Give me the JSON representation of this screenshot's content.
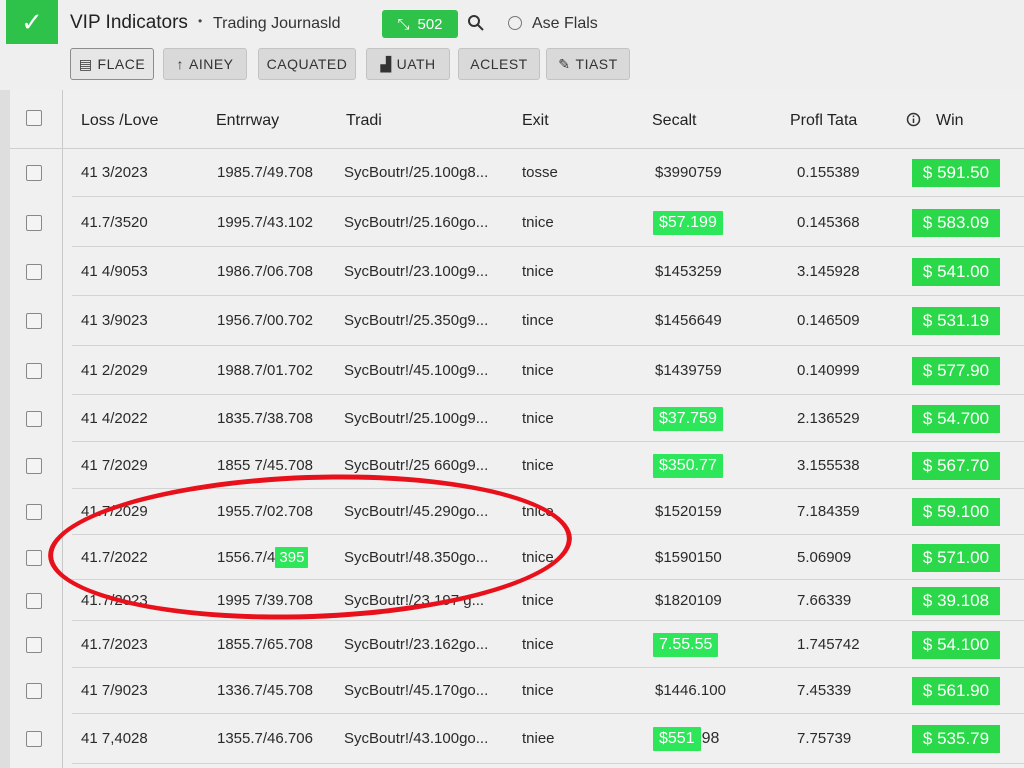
{
  "app": {
    "title": "VIP Indicators",
    "separator": "•",
    "subtitle": "Trading Journasld",
    "count_badge": "502",
    "filter_label": "Ase Flals"
  },
  "toolbar": [
    {
      "icon": "grid-icon",
      "glyph": "▤",
      "label": "FLACE"
    },
    {
      "icon": "arrow-up-icon",
      "glyph": "↑",
      "label": "AINEY"
    },
    {
      "icon": "",
      "glyph": "",
      "label": "CAQUATED"
    },
    {
      "icon": "chart-icon",
      "glyph": "▟",
      "label": "UATH"
    },
    {
      "icon": "",
      "glyph": "",
      "label": "ACLEST"
    },
    {
      "icon": "pencil-icon",
      "glyph": "✎",
      "label": "TIAST"
    }
  ],
  "columns": [
    "Loss /Love",
    "Entrrway",
    "Tradi",
    "Exit",
    "Secalt",
    "Profl Tata",
    "Win"
  ],
  "rows": [
    {
      "loss": "41 3/2023",
      "entry": "1985.7/49.708",
      "trade": "SycBoutr!/25.100g8...",
      "exit": "tosse",
      "secalt": "$3990759",
      "profit": "0.155389",
      "win": "$ 591.50"
    },
    {
      "loss": "41.7/3520",
      "entry": "1995.7/43.102",
      "trade": "SycBoutr!/25.160go...",
      "exit": "tnice",
      "secalt": "$57.199",
      "profit": "0.145368",
      "win": "$ 583.09"
    },
    {
      "loss": "41 4/9053",
      "entry": "1986.7/06.708",
      "trade": "SycBoutr!/23.100g9...",
      "exit": "tnice",
      "secalt": "$1453259",
      "profit": "3.145928",
      "win": "$ 541.00"
    },
    {
      "loss": "41 3/9023",
      "entry": "1956.7/00.702",
      "trade": "SycBoutr!/25.350g9...",
      "exit": "tince",
      "secalt": "$1456649",
      "profit": "0.146509",
      "win": "$ 531.19"
    },
    {
      "loss": "41 2/2029",
      "entry": "1988.7/01.702",
      "trade": "SycBoutr!/45.100g9...",
      "exit": "tnice",
      "secalt": "$1439759",
      "profit": "0.140999",
      "win": "$ 577.90"
    },
    {
      "loss": "41 4/2022",
      "entry": "1835.7/38.708",
      "trade": "SycBoutr!/25.100g9...",
      "exit": "tnice",
      "secalt": "$37.759",
      "profit": "2.136529",
      "win": "$ 54.700"
    },
    {
      "loss": "41 7/2029",
      "entry": "1855 7/45.708",
      "trade": "SycBoutr!/25 660g9...",
      "exit": "tnice",
      "secalt": "$350.77",
      "profit": "3.155538",
      "win": "$ 567.70"
    },
    {
      "loss": "41.7/2029",
      "entry": "1955.7/02.708",
      "trade": "SycBoutr!/45.290go...",
      "exit": "tnice",
      "secalt": "$1520159",
      "profit": "7.184359",
      "win": "$ 59.100"
    },
    {
      "loss": "41.7/2022",
      "entry": "1556.7/4",
      "entry_badge": "395",
      "trade": "SycBoutr!/48.350go...",
      "exit": "tnice",
      "secalt": "$1590150",
      "profit": "5.06909",
      "win": "$ 571.00"
    },
    {
      "loss": "41.7/2023",
      "entry": "1995 7/39.708",
      "trade": "SycBoutr!/23 197 g...",
      "exit": "tnice",
      "secalt": "$1820109",
      "profit": "7.66339",
      "win": "$ 39.108"
    },
    {
      "loss": "41.7/2023",
      "entry": "1855.7/65.708",
      "trade": "SycBoutr!/23.162go...",
      "exit": "tnice",
      "secalt": "7.55.55",
      "profit": "1.745742",
      "win": "$ 54.100"
    },
    {
      "loss": "41 7/9023",
      "entry": "1336.7/45.708",
      "trade": "SycBoutr!/45.170go...",
      "exit": "tnice",
      "secalt": "$1446.100",
      "profit": "7.45339",
      "win": "$ 561.90"
    },
    {
      "loss": "41 7,4028",
      "entry": "1355.7/46.706",
      "trade": "SycBoutr!/43.100go...",
      "exit": "tniee",
      "secalt": "$551",
      "secalt_tail": "98",
      "profit": "7.75739",
      "win": "$ 535.79"
    }
  ],
  "highlighted_secalt_rows": [
    1,
    5,
    6,
    10,
    12
  ],
  "colors": {
    "accent": "#2ec24a",
    "win": "#2bd84a",
    "highlight": "#2ee65a",
    "annotation": "#e8101a"
  }
}
